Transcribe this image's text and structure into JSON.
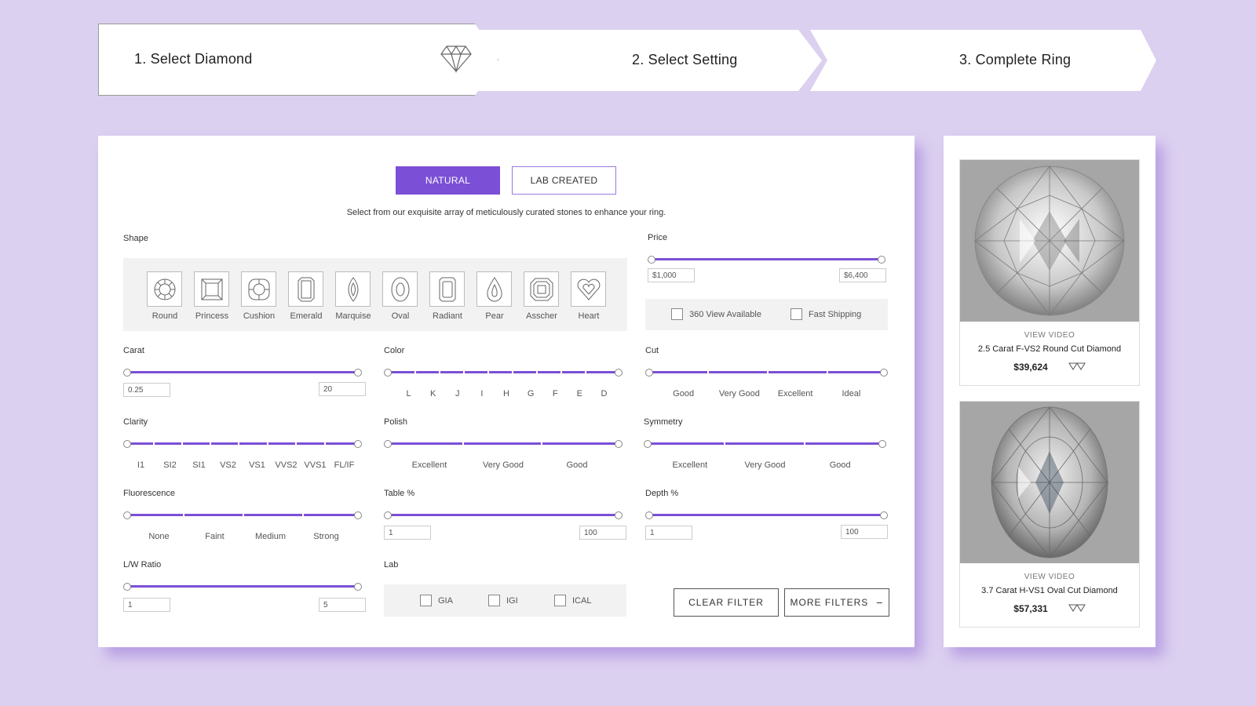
{
  "steps": [
    {
      "label": "1. Select Diamond",
      "icon": "diamond-icon"
    },
    {
      "label": "2. Select Setting",
      "icon": "ring-icon"
    },
    {
      "label": "3. Complete Ring",
      "icon": "diamond-ring-icon"
    }
  ],
  "toggle": {
    "natural": "NATURAL",
    "lab": "LAB CREATED",
    "active": "natural",
    "accent": "#7b4fd6"
  },
  "intro": "Select from our exquisite array of meticulously curated stones to enhance your ring.",
  "shape": {
    "label": "Shape",
    "items": [
      "Round",
      "Princess",
      "Cushion",
      "Emerald",
      "Marquise",
      "Oval",
      "Radiant",
      "Pear",
      "Asscher",
      "Heart"
    ]
  },
  "price": {
    "label": "Price",
    "min": "$1,000",
    "max": "$6,400"
  },
  "options": {
    "view360": "360 View Available",
    "fast_shipping": "Fast Shipping"
  },
  "carat": {
    "label": "Carat",
    "min": "0.25",
    "max": "20"
  },
  "color": {
    "label": "Color",
    "ticks": [
      "L",
      "K",
      "J",
      "I",
      "H",
      "G",
      "F",
      "E",
      "D"
    ]
  },
  "cut": {
    "label": "Cut",
    "ticks": [
      "Good",
      "Very Good",
      "Excellent",
      "Ideal"
    ]
  },
  "clarity": {
    "label": "Clarity",
    "ticks": [
      "I1",
      "SI2",
      "SI1",
      "VS2",
      "VS1",
      "VVS2",
      "VVS1",
      "FL/IF"
    ]
  },
  "polish": {
    "label": "Polish",
    "ticks": [
      "Excellent",
      "Very Good",
      "Good"
    ]
  },
  "symmetry": {
    "label": "Symmetry",
    "ticks": [
      "Excellent",
      "Very Good",
      "Good"
    ]
  },
  "fluorescence": {
    "label": "Fluorescence",
    "ticks": [
      "None",
      "Faint",
      "Medium",
      "Strong"
    ]
  },
  "table": {
    "label": "Table %",
    "min": "1",
    "max": "100"
  },
  "depth": {
    "label": "Depth %",
    "min": "1",
    "max": "100"
  },
  "lw": {
    "label": "L/W Ratio",
    "min": "1",
    "max": "5"
  },
  "lab": {
    "label": "Lab",
    "items": [
      "GIA",
      "IGI",
      "ICAL"
    ]
  },
  "buttons": {
    "clear": "CLEAR FILTER",
    "more": "MORE FILTERS",
    "more_icon": "minus-icon"
  },
  "products": [
    {
      "view": "VIEW VIDEO",
      "name": "2.5 Carat F-VS2 Round Cut Diamond",
      "price": "$39,624"
    },
    {
      "view": "VIEW VIDEO",
      "name": "3.7 Carat H-VS1 Oval Cut Diamond",
      "price": "$57,331"
    }
  ]
}
